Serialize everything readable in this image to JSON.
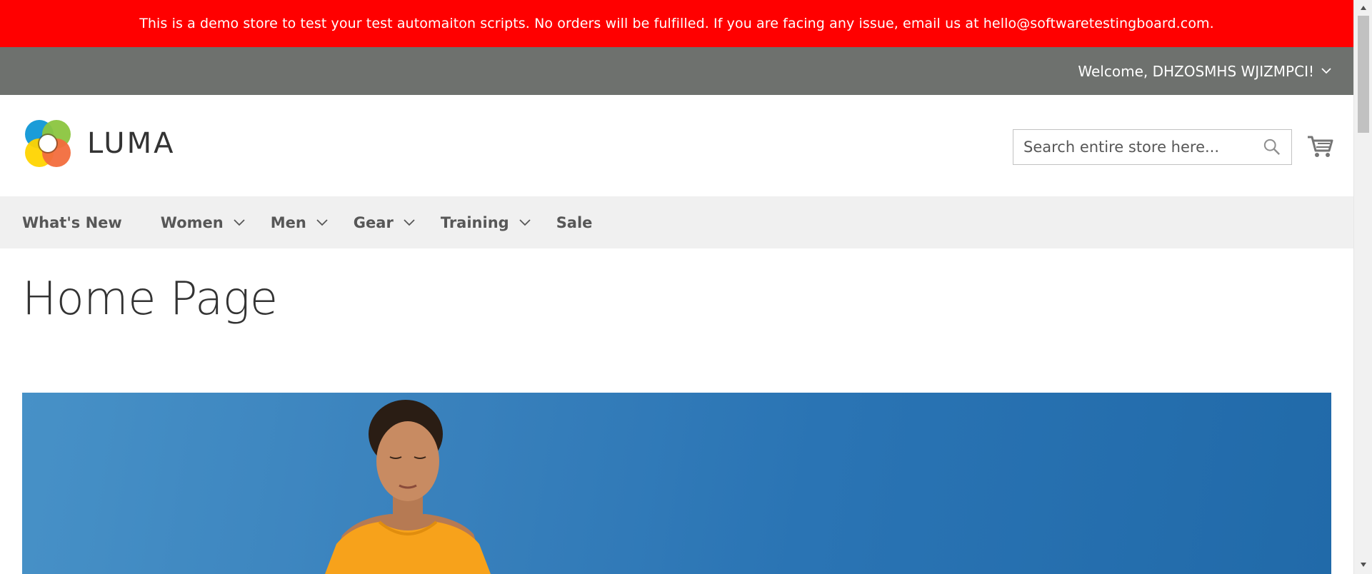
{
  "notice": {
    "text": "This is a demo store to test your test automaiton scripts. No orders will be fulfilled. If you are facing any issue, email us at hello@softwaretestingboard.com."
  },
  "panel": {
    "welcome": "Welcome, DHZOSMHS WJIZMPCI!",
    "dropdown_icon": "chevron-down-icon"
  },
  "header": {
    "logo_text": "LUMA",
    "search": {
      "placeholder": "Search entire store here...",
      "value": "",
      "icon": "search-icon"
    },
    "cart_icon": "cart-icon"
  },
  "nav": {
    "items": [
      {
        "label": "What's New",
        "has_dropdown": false
      },
      {
        "label": "Women",
        "has_dropdown": true
      },
      {
        "label": "Men",
        "has_dropdown": true
      },
      {
        "label": "Gear",
        "has_dropdown": true
      },
      {
        "label": "Training",
        "has_dropdown": true
      },
      {
        "label": "Sale",
        "has_dropdown": false
      }
    ]
  },
  "main": {
    "page_title": "Home Page"
  },
  "colors": {
    "notice_bg": "#ff0000",
    "panel_bg": "#6e716e",
    "nav_bg": "#f0f0f0",
    "hero_sky": "#2a74b4",
    "shirt": "#f7a21b"
  }
}
